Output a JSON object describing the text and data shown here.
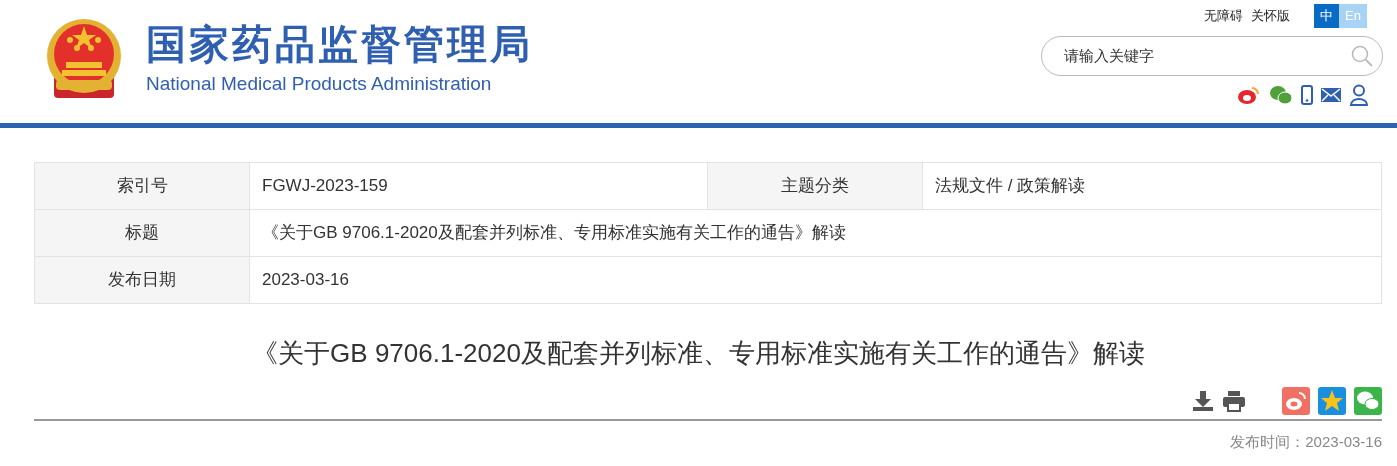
{
  "header": {
    "logo_title": "国家药品监督管理局",
    "logo_subtitle": "National Medical Products Administration",
    "links": [
      "无障碍",
      "关怀版"
    ],
    "languages": [
      {
        "label": "中",
        "selected": true
      },
      {
        "label": "En",
        "selected": false
      }
    ],
    "search": {
      "placeholder": "请输入关键字"
    }
  },
  "info_table": {
    "rows": [
      [
        {
          "label": "索引号",
          "value": "FGWJ-2023-159"
        },
        {
          "label": "主题分类",
          "value": "法规文件 / 政策解读"
        }
      ],
      [
        {
          "label": "标题",
          "value": "《关于GB 9706.1-2020及配套并列标准、专用标准实施有关工作的通告》解读"
        }
      ],
      [
        {
          "label": "发布日期",
          "value": "2023-03-16"
        }
      ]
    ]
  },
  "article": {
    "title": "《关于GB 9706.1-2020及配套并列标准、专用标准实施有关工作的通告》解读",
    "publish_time": "发布时间：2023-03-16"
  }
}
